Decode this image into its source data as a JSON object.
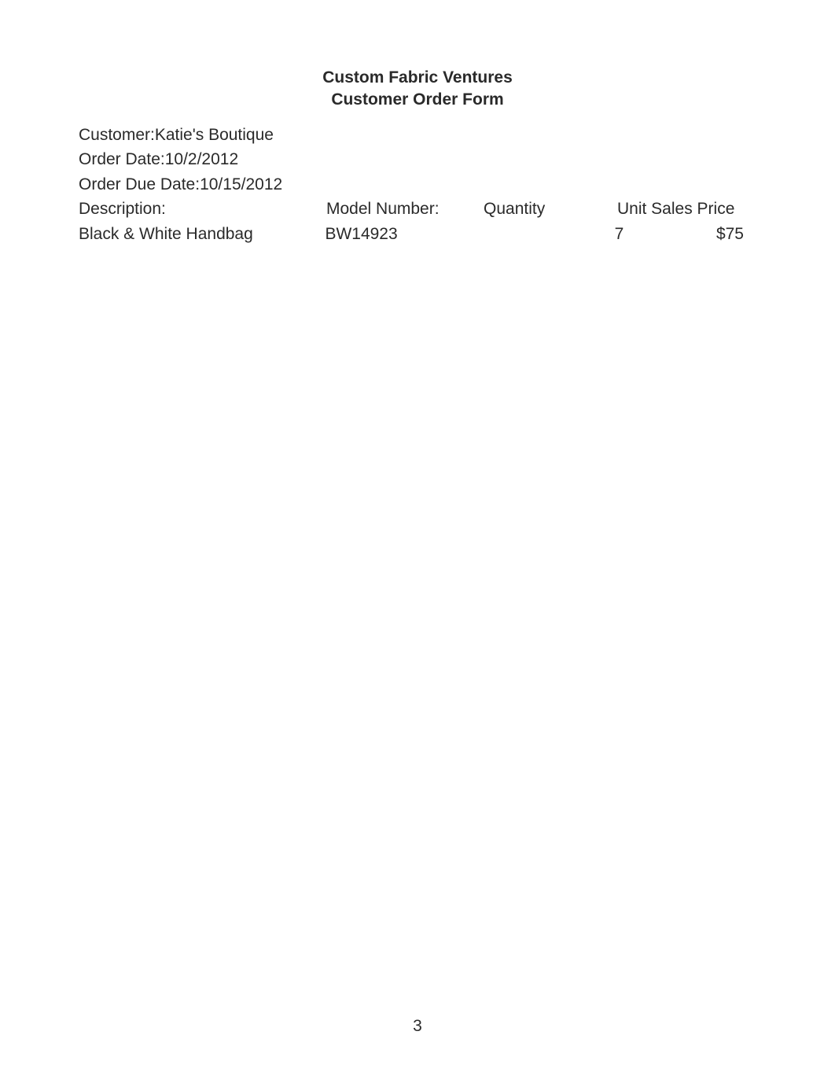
{
  "title_line1": "Custom Fabric Ventures",
  "title_line2": "Customer Order Form",
  "customer_label": "Customer: ",
  "customer_value": "Katie's  Boutique",
  "order_date_label": "Order Date: ",
  "order_date_value": "10/2/2012",
  "order_due_date_label": "Order Due Date: ",
  "order_due_date_value": "10/15/2012",
  "headers": {
    "description": "Description:",
    "model": "Model  Number:",
    "quantity": "Quantity",
    "unit_price": "Unit Sales Price"
  },
  "row": {
    "description": "Black & White Handbag",
    "model": "BW14923",
    "quantity": "7",
    "unit_price": "$75"
  },
  "page_number": "3"
}
